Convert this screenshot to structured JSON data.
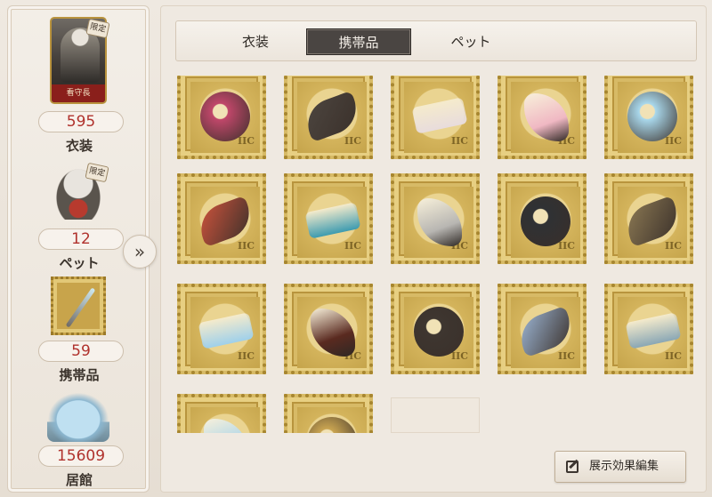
{
  "sidebar": {
    "costume": {
      "card_name": "看守長",
      "limited_tag": "限定",
      "count": "595",
      "label": "衣装"
    },
    "pet": {
      "limited_tag": "限定",
      "count": "12",
      "label": "ペット"
    },
    "accessory": {
      "count": "59",
      "label": "携帯品"
    },
    "lodge": {
      "count": "15609",
      "label": "居館"
    }
  },
  "expand_toggle_icon": "double-chevron-right-icon",
  "tabs": [
    {
      "label": "衣装",
      "active": false
    },
    {
      "label": "携帯品",
      "active": true
    },
    {
      "label": "ペット",
      "active": false
    }
  ],
  "stamp_code": "IIC",
  "items": [
    {
      "icon": "lantern-orb-icon",
      "color": "#c0476a"
    },
    {
      "icon": "doll-icon",
      "color": "#4d4640"
    },
    {
      "icon": "winged-letter-icon",
      "color": "#e8dcdc"
    },
    {
      "icon": "cherry-branch-icon",
      "color": "#f0b8c3"
    },
    {
      "icon": "crystal-heart-icon",
      "color": "#a9d8ec"
    },
    {
      "icon": "phoenix-wing-icon",
      "color": "#d1543d"
    },
    {
      "icon": "dragon-scepter-icon",
      "color": "#3d9bb0"
    },
    {
      "icon": "harmonica-icon",
      "color": "#b8b6b2"
    },
    {
      "icon": "dark-cannon-icon",
      "color": "#2f3134"
    },
    {
      "icon": "pocket-watch-icon",
      "color": "#8d7a54"
    },
    {
      "icon": "frost-lotus-icon",
      "color": "#9fd0ea"
    },
    {
      "icon": "crystal-cone-icon",
      "color": "#5a2a20"
    },
    {
      "icon": "gilded-vase-icon",
      "color": "#3e3630"
    },
    {
      "icon": "moon-orb-staff-icon",
      "color": "#9eb8d8"
    },
    {
      "icon": "star-wand-icon",
      "color": "#8aa7b5"
    },
    {
      "icon": "snowflake-item-icon",
      "color": "#a7d3ea"
    },
    {
      "icon": "partial-item-icon",
      "color": "#c9a451"
    }
  ],
  "edit_button": {
    "icon": "edit-icon",
    "label": "展示効果編集"
  }
}
